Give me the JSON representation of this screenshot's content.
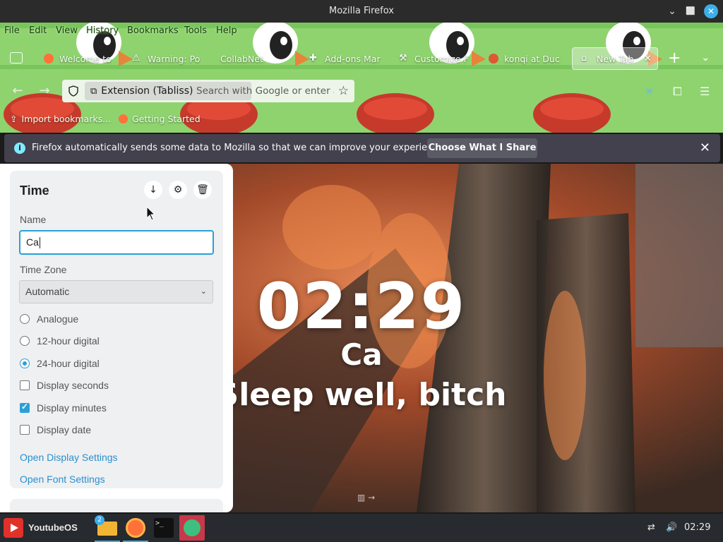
{
  "window": {
    "title": "Mozilla Firefox",
    "controls": {
      "minimize": "⌄",
      "maximize": "⬜",
      "close": "✕"
    }
  },
  "menubar": [
    "File",
    "Edit",
    "View",
    "History",
    "Bookmarks",
    "Tools",
    "Help"
  ],
  "tabs": [
    {
      "label": "Welcome to",
      "icon": "firefox-icon"
    },
    {
      "label": "Warning: Po",
      "icon": "warning-icon"
    },
    {
      "label": "CollabNet",
      "icon": ""
    },
    {
      "label": "Add-ons Mar",
      "icon": "puzzle-icon"
    },
    {
      "label": "Customize F",
      "icon": "customize-icon"
    },
    {
      "label": "konqi at Duc",
      "icon": "duckduckgo-icon"
    },
    {
      "label": "New Tab",
      "icon": "tabliss-icon",
      "active": true
    }
  ],
  "toolbar": {
    "extension_label": "Extension (Tabliss)",
    "url_placeholder": "Search with Google or enter ac"
  },
  "bookmarks": [
    {
      "label": "Import bookmarks...",
      "icon": "import-icon"
    },
    {
      "label": "Getting Started",
      "icon": "firefox-icon"
    }
  ],
  "notification": {
    "text": "Firefox automatically sends some data to Mozilla so that we can improve your experience.",
    "button": "Choose What I Share"
  },
  "panel": {
    "title": "Time",
    "name_label": "Name",
    "name_value": "Ca",
    "timezone_label": "Time Zone",
    "timezone_value": "Automatic",
    "options": [
      {
        "label": "Analogue",
        "type": "radio",
        "checked": false
      },
      {
        "label": "12-hour digital",
        "type": "radio",
        "checked": false
      },
      {
        "label": "24-hour digital",
        "type": "radio",
        "checked": true
      },
      {
        "label": "Display seconds",
        "type": "checkbox",
        "checked": false
      },
      {
        "label": "Display minutes",
        "type": "checkbox",
        "checked": true
      },
      {
        "label": "Display date",
        "type": "checkbox",
        "checked": false
      }
    ],
    "links": [
      "Open Display Settings",
      "Open Font Settings"
    ]
  },
  "dashboard": {
    "time": "02:29",
    "name": "Ca",
    "greeting": "Sleep well, bitch"
  },
  "taskbar": {
    "start_label": "YoutubeOS",
    "files_badge": "2",
    "clock": "02:29"
  },
  "colors": {
    "accent": "#3daee9",
    "link": "#2a8fd0",
    "theme_green": "#8fd36f",
    "notification_bg": "#42414d"
  }
}
